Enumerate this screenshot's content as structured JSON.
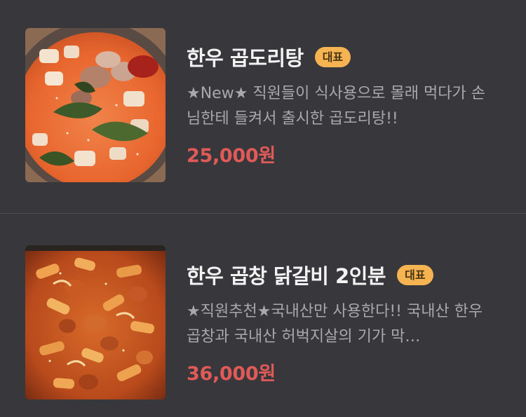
{
  "menu": {
    "items": [
      {
        "name": "한우 곱도리탕",
        "badge": "대표",
        "description": "★New★ 직원들이 식사용으로 몰래 먹다가 손님한테 들켜서 출시한 곱도리탕!!",
        "price": "25,000원",
        "image": "food-photo-gopdoritang"
      },
      {
        "name": "한우 곱창 닭갈비 2인분",
        "badge": "대표",
        "description": "★직원추천★국내산만 사용한다!! 국내산 한우 곱창과 국내산 허벅지살의 기가 막…",
        "price": "36,000원",
        "image": "food-photo-gopchang-dakgalbi"
      }
    ]
  },
  "colors": {
    "background": "#38373c",
    "badge": "#f5b451",
    "price": "#e05a57",
    "description": "#a9a8ad"
  }
}
